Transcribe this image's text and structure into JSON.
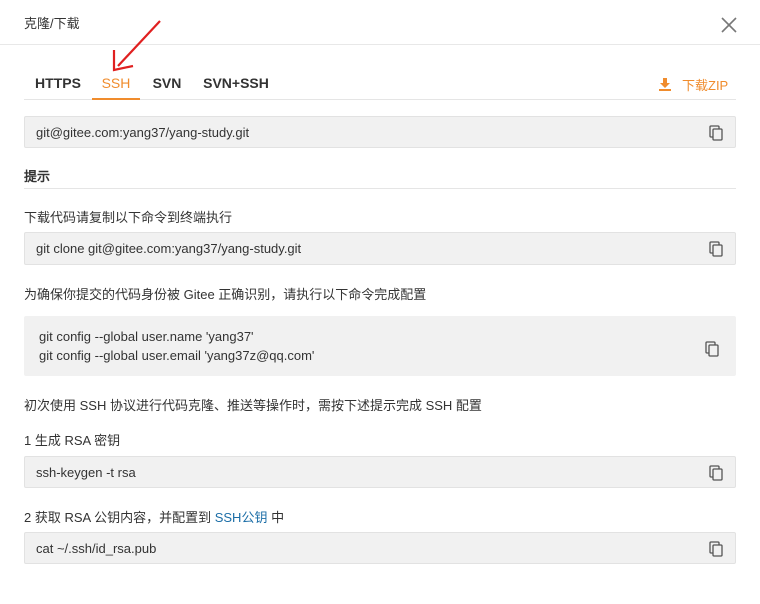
{
  "dialog": {
    "title": "克隆/下载"
  },
  "tabs": [
    {
      "label": "HTTPS",
      "active": false
    },
    {
      "label": "SSH",
      "active": true
    },
    {
      "label": "SVN",
      "active": false
    },
    {
      "label": "SVN+SSH",
      "active": false
    }
  ],
  "download_zip": {
    "label": "下载ZIP"
  },
  "repo_url": "git@gitee.com:yang37/yang-study.git",
  "hint": {
    "heading": "提示",
    "copy_instruction": "下载代码请复制以下命令到终端执行",
    "clone_command": "git clone git@gitee.com:yang37/yang-study.git",
    "identity_instruction": "为确保你提交的代码身份被 Gitee 正确识别，请执行以下命令完成配置",
    "config_name_command": "git config --global user.name 'yang37'",
    "config_email_command": "git config --global user.email 'yang37z@qq.com'",
    "ssh_first_use": "初次使用 SSH 协议进行代码克隆、推送等操作时，需按下述提示完成 SSH 配置",
    "step1_label": "1 生成 RSA 密钥",
    "step1_command": "ssh-keygen -t rsa",
    "step2_prefix": "2 获取 RSA 公钥内容，并配置到",
    "step2_link": "SSH公钥",
    "step2_suffix": "中",
    "step2_command": "cat ~/.ssh/id_rsa.pub"
  },
  "colors": {
    "accent": "#f08c2d",
    "link": "#1c6ea7",
    "annotation_arrow": "#e02020",
    "code_bg": "#f1f1f1"
  }
}
